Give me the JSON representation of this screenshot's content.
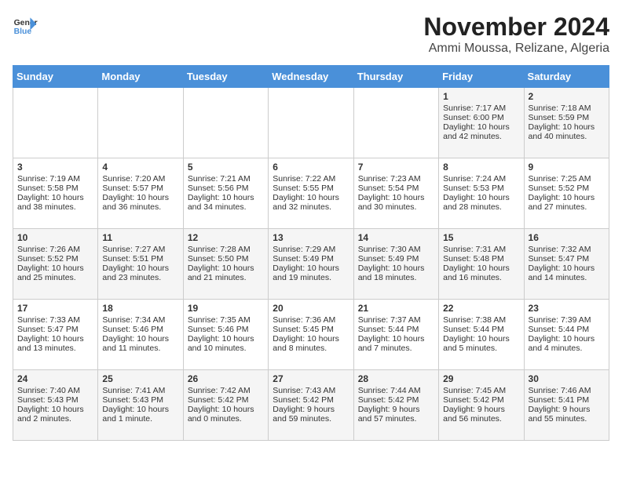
{
  "logo": {
    "line1": "General",
    "line2": "Blue"
  },
  "title": "November 2024",
  "location": "Ammi Moussa, Relizane, Algeria",
  "weekdays": [
    "Sunday",
    "Monday",
    "Tuesday",
    "Wednesday",
    "Thursday",
    "Friday",
    "Saturday"
  ],
  "weeks": [
    [
      {
        "day": "",
        "info": ""
      },
      {
        "day": "",
        "info": ""
      },
      {
        "day": "",
        "info": ""
      },
      {
        "day": "",
        "info": ""
      },
      {
        "day": "",
        "info": ""
      },
      {
        "day": "1",
        "info": "Sunrise: 7:17 AM\nSunset: 6:00 PM\nDaylight: 10 hours\nand 42 minutes."
      },
      {
        "day": "2",
        "info": "Sunrise: 7:18 AM\nSunset: 5:59 PM\nDaylight: 10 hours\nand 40 minutes."
      }
    ],
    [
      {
        "day": "3",
        "info": "Sunrise: 7:19 AM\nSunset: 5:58 PM\nDaylight: 10 hours\nand 38 minutes."
      },
      {
        "day": "4",
        "info": "Sunrise: 7:20 AM\nSunset: 5:57 PM\nDaylight: 10 hours\nand 36 minutes."
      },
      {
        "day": "5",
        "info": "Sunrise: 7:21 AM\nSunset: 5:56 PM\nDaylight: 10 hours\nand 34 minutes."
      },
      {
        "day": "6",
        "info": "Sunrise: 7:22 AM\nSunset: 5:55 PM\nDaylight: 10 hours\nand 32 minutes."
      },
      {
        "day": "7",
        "info": "Sunrise: 7:23 AM\nSunset: 5:54 PM\nDaylight: 10 hours\nand 30 minutes."
      },
      {
        "day": "8",
        "info": "Sunrise: 7:24 AM\nSunset: 5:53 PM\nDaylight: 10 hours\nand 28 minutes."
      },
      {
        "day": "9",
        "info": "Sunrise: 7:25 AM\nSunset: 5:52 PM\nDaylight: 10 hours\nand 27 minutes."
      }
    ],
    [
      {
        "day": "10",
        "info": "Sunrise: 7:26 AM\nSunset: 5:52 PM\nDaylight: 10 hours\nand 25 minutes."
      },
      {
        "day": "11",
        "info": "Sunrise: 7:27 AM\nSunset: 5:51 PM\nDaylight: 10 hours\nand 23 minutes."
      },
      {
        "day": "12",
        "info": "Sunrise: 7:28 AM\nSunset: 5:50 PM\nDaylight: 10 hours\nand 21 minutes."
      },
      {
        "day": "13",
        "info": "Sunrise: 7:29 AM\nSunset: 5:49 PM\nDaylight: 10 hours\nand 19 minutes."
      },
      {
        "day": "14",
        "info": "Sunrise: 7:30 AM\nSunset: 5:49 PM\nDaylight: 10 hours\nand 18 minutes."
      },
      {
        "day": "15",
        "info": "Sunrise: 7:31 AM\nSunset: 5:48 PM\nDaylight: 10 hours\nand 16 minutes."
      },
      {
        "day": "16",
        "info": "Sunrise: 7:32 AM\nSunset: 5:47 PM\nDaylight: 10 hours\nand 14 minutes."
      }
    ],
    [
      {
        "day": "17",
        "info": "Sunrise: 7:33 AM\nSunset: 5:47 PM\nDaylight: 10 hours\nand 13 minutes."
      },
      {
        "day": "18",
        "info": "Sunrise: 7:34 AM\nSunset: 5:46 PM\nDaylight: 10 hours\nand 11 minutes."
      },
      {
        "day": "19",
        "info": "Sunrise: 7:35 AM\nSunset: 5:46 PM\nDaylight: 10 hours\nand 10 minutes."
      },
      {
        "day": "20",
        "info": "Sunrise: 7:36 AM\nSunset: 5:45 PM\nDaylight: 10 hours\nand 8 minutes."
      },
      {
        "day": "21",
        "info": "Sunrise: 7:37 AM\nSunset: 5:44 PM\nDaylight: 10 hours\nand 7 minutes."
      },
      {
        "day": "22",
        "info": "Sunrise: 7:38 AM\nSunset: 5:44 PM\nDaylight: 10 hours\nand 5 minutes."
      },
      {
        "day": "23",
        "info": "Sunrise: 7:39 AM\nSunset: 5:44 PM\nDaylight: 10 hours\nand 4 minutes."
      }
    ],
    [
      {
        "day": "24",
        "info": "Sunrise: 7:40 AM\nSunset: 5:43 PM\nDaylight: 10 hours\nand 2 minutes."
      },
      {
        "day": "25",
        "info": "Sunrise: 7:41 AM\nSunset: 5:43 PM\nDaylight: 10 hours\nand 1 minute."
      },
      {
        "day": "26",
        "info": "Sunrise: 7:42 AM\nSunset: 5:42 PM\nDaylight: 10 hours\nand 0 minutes."
      },
      {
        "day": "27",
        "info": "Sunrise: 7:43 AM\nSunset: 5:42 PM\nDaylight: 9 hours\nand 59 minutes."
      },
      {
        "day": "28",
        "info": "Sunrise: 7:44 AM\nSunset: 5:42 PM\nDaylight: 9 hours\nand 57 minutes."
      },
      {
        "day": "29",
        "info": "Sunrise: 7:45 AM\nSunset: 5:42 PM\nDaylight: 9 hours\nand 56 minutes."
      },
      {
        "day": "30",
        "info": "Sunrise: 7:46 AM\nSunset: 5:41 PM\nDaylight: 9 hours\nand 55 minutes."
      }
    ]
  ]
}
